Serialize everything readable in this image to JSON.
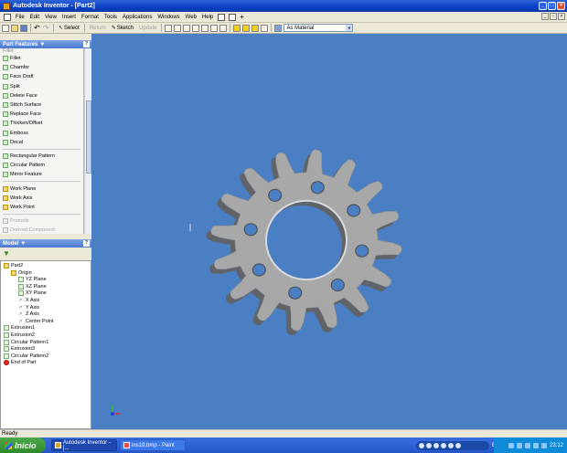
{
  "window": {
    "title": "Autodesk Inventor - [Part2]"
  },
  "menu": [
    "File",
    "Edit",
    "View",
    "Insert",
    "Format",
    "Tools",
    "Applications",
    "Windows",
    "Web",
    "Help"
  ],
  "toolbar": {
    "select_label": "Select",
    "return_label": "Return",
    "sketch_label": "Sketch",
    "update_label": "Update",
    "material_value": "As Material"
  },
  "part_features": {
    "title": "Part Features",
    "partial_top": "Fillet",
    "items": [
      {
        "label": "Fillet",
        "icon": "fillet-icon"
      },
      {
        "label": "Chamfer",
        "icon": "chamfer-icon"
      },
      {
        "label": "Face Draft",
        "icon": "face-draft-icon"
      },
      {
        "label": "Split",
        "icon": "split-icon"
      },
      {
        "label": "Delete Face",
        "icon": "delete-face-icon"
      },
      {
        "label": "Stitch Surface",
        "icon": "stitch-surface-icon"
      },
      {
        "label": "Replace Face",
        "icon": "replace-face-icon"
      },
      {
        "label": "Thicken/Offset",
        "icon": "thicken-icon"
      },
      {
        "label": "Emboss",
        "icon": "emboss-icon"
      },
      {
        "label": "Decal",
        "icon": "decal-icon"
      },
      {
        "label": "Rectangular Pattern",
        "icon": "rect-pattern-icon"
      },
      {
        "label": "Circular Pattern",
        "icon": "circ-pattern-icon"
      },
      {
        "label": "Mirror Feature",
        "icon": "mirror-icon"
      },
      {
        "label": "Work Plane",
        "icon": "work-plane-icon"
      },
      {
        "label": "Work Axis",
        "icon": "work-axis-icon"
      },
      {
        "label": "Work Point",
        "icon": "work-point-icon"
      },
      {
        "label": "Promote",
        "icon": "promote-icon"
      },
      {
        "label": "Derived Component",
        "icon": "derived-icon"
      }
    ]
  },
  "model": {
    "title": "Model",
    "tree": [
      {
        "label": "Part2",
        "level": 0,
        "icon": "folder"
      },
      {
        "label": "Origin",
        "level": 1,
        "icon": "folder"
      },
      {
        "label": "YZ Plane",
        "level": 2,
        "icon": "plane"
      },
      {
        "label": "XZ Plane",
        "level": 2,
        "icon": "plane"
      },
      {
        "label": "XY Plane",
        "level": 2,
        "icon": "plane"
      },
      {
        "label": "X Axis",
        "level": 2,
        "icon": "axis"
      },
      {
        "label": "Y Axis",
        "level": 2,
        "icon": "axis"
      },
      {
        "label": "Z Axis",
        "level": 2,
        "icon": "axis"
      },
      {
        "label": "Center Point",
        "level": 2,
        "icon": "axis"
      },
      {
        "label": "Extrusion1",
        "level": 0,
        "icon": "feature"
      },
      {
        "label": "Extrusion2",
        "level": 0,
        "icon": "feature"
      },
      {
        "label": "Circular Pattern1",
        "level": 0,
        "icon": "feature"
      },
      {
        "label": "Extrusion3",
        "level": 0,
        "icon": "feature"
      },
      {
        "label": "Circular Pattern2",
        "level": 0,
        "icon": "feature"
      },
      {
        "label": "End of Part",
        "level": 0,
        "icon": "end"
      }
    ]
  },
  "status": {
    "text": "Ready"
  },
  "taskbar": {
    "start_label": "Inicio",
    "buttons": [
      "Autodesk Inventor - [...",
      "ins19.bmp - Paint"
    ],
    "lang": "ES",
    "clock": "23:12"
  },
  "colors": {
    "viewport": "#4a7fc4",
    "gear": "#a8a8a8",
    "titlebar": "#0a3fc5"
  }
}
